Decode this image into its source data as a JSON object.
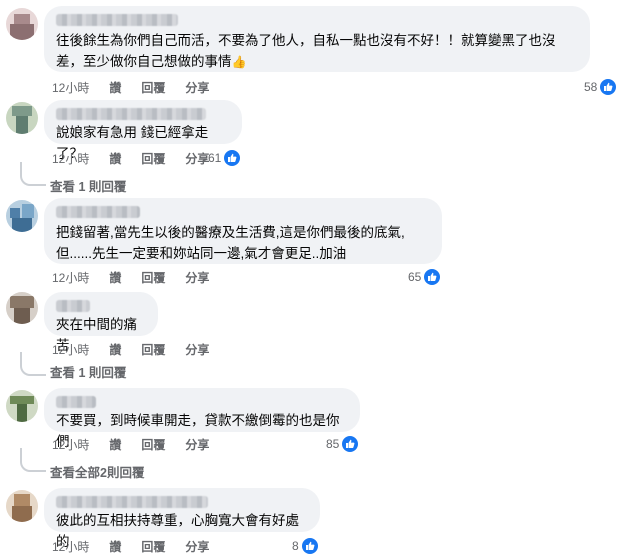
{
  "comments": [
    {
      "text": "往後餘生為你們自己而活，不要為了他人，自私一點也沒有不好！！就算變黑了也沒差，至少做你自己想做的事情",
      "emoji": "👍",
      "time": "12小時",
      "like_label": "讚",
      "reply_label": "回覆",
      "share_label": "分享",
      "likes": "58",
      "view_replies": ""
    },
    {
      "text": "說娘家有急用 錢已經拿走了？",
      "time": "12小時",
      "like_label": "讚",
      "reply_label": "回覆",
      "share_label": "分享",
      "likes": "61",
      "view_replies": "查看 1 則回覆"
    },
    {
      "text": "把錢留著,當先生以後的醫療及生活費,這是你們最後的底氣,但......先生一定要和妳站同一邊,氣才會更足..加油",
      "time": "12小時",
      "like_label": "讚",
      "reply_label": "回覆",
      "share_label": "分享",
      "likes": "65",
      "view_replies": ""
    },
    {
      "text": "夾在中間的痛苦",
      "time": "12小時",
      "like_label": "讚",
      "reply_label": "回覆",
      "share_label": "分享",
      "likes": "",
      "view_replies": "查看 1 則回覆"
    },
    {
      "text": "不要買，到時候車開走，貸款不繳倒霉的也是你們",
      "time": "12小時",
      "like_label": "讚",
      "reply_label": "回覆",
      "share_label": "分享",
      "likes": "85",
      "view_replies": "查看全部2則回覆"
    },
    {
      "text": "彼此的互相扶持尊重，心胸寬大會有好處的",
      "time": "12小時",
      "like_label": "讚",
      "reply_label": "回覆",
      "share_label": "分享",
      "likes": "8",
      "view_replies": ""
    }
  ],
  "icons": {
    "like": "like-thumb-icon",
    "avatar": "blurred-avatar"
  },
  "colors": {
    "bubble": "#f0f2f5",
    "like_badge": "#1877f2",
    "meta_text": "#65676b"
  }
}
